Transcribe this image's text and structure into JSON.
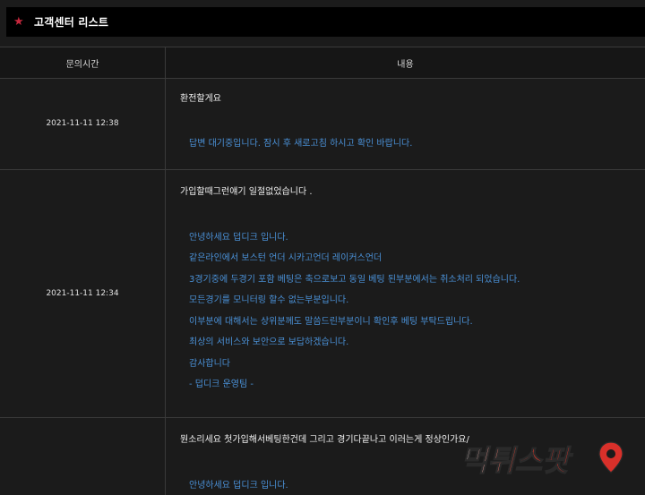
{
  "page": {
    "title": "고객센터 리스트",
    "star_icon": "star-icon",
    "accent_color": "#c8283e",
    "answer_color": "#4a90d6"
  },
  "table": {
    "headers": {
      "time": "문의시간",
      "content": "내용"
    },
    "rows": [
      {
        "time": "2021-11-11 12:38",
        "question": "환전할게요",
        "answer": [
          "답변 대기중입니다. 잠시 후 새로고침 하시고 확인 바랍니다."
        ]
      },
      {
        "time": "2021-11-11 12:34",
        "question": "가입할때그런얘기 일절없었습니다 .",
        "answer": [
          "안녕하세요 덥디크 입니다.",
          "같은라인에서 보스턴 언더 시카고언더 레이커스언더",
          "3경기중에 두경기 포함 베팅은 축으로보고 동일 베팅 된부분에서는 취소처리 되었습니다.",
          "모든경기를 모니터링 할수 없는부분입니다.",
          "이부분에 대해서는 상위분께도 말씀드린부분이니 확인후 베팅 부탁드립니다.",
          "최상의 서비스와 보안으로 보답하겠습니다.",
          "감사합니다",
          "- 덥디크 운영팀 -"
        ]
      },
      {
        "time": "",
        "question": "뭔소리세요 첫가입해서베팅한건데 그리고 경기다끝나고 이러는게 정상인가요/",
        "answer": [
          "안녕하세요 덥디크 입니다."
        ]
      }
    ]
  },
  "watermark": {
    "text": "먹튀스팟",
    "icon": "location-pin-icon"
  }
}
